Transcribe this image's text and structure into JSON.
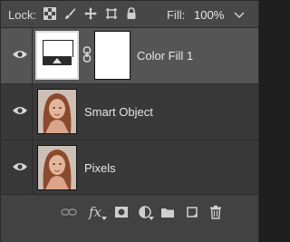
{
  "lockbar": {
    "lock_label": "Lock:",
    "fill_label": "Fill:",
    "fill_value": "100%",
    "icons": [
      "lock-transparent-pixels-icon",
      "lock-image-pixels-icon",
      "lock-position-icon",
      "prevent-auto-nesting-icon",
      "lock-all-icon",
      "chevron-down-icon"
    ]
  },
  "layers": [
    {
      "name": "Color Fill 1",
      "selected": true,
      "type": "fill-layer-with-mask"
    },
    {
      "name": "Smart Object",
      "selected": false,
      "type": "smart-object"
    },
    {
      "name": "Pixels",
      "selected": false,
      "type": "pixel-layer"
    }
  ],
  "bottombar": {
    "fx_label": "fx",
    "icons": [
      "link-layers-icon",
      "layer-style-icon",
      "add-mask-icon",
      "adjustment-layer-icon",
      "group-folder-icon",
      "new-layer-icon",
      "trash-icon"
    ]
  },
  "colors": {
    "panel_bg": "#393939",
    "selected_row": "#555555",
    "topbar_bg": "#474747",
    "text": "#e6e6e6"
  }
}
